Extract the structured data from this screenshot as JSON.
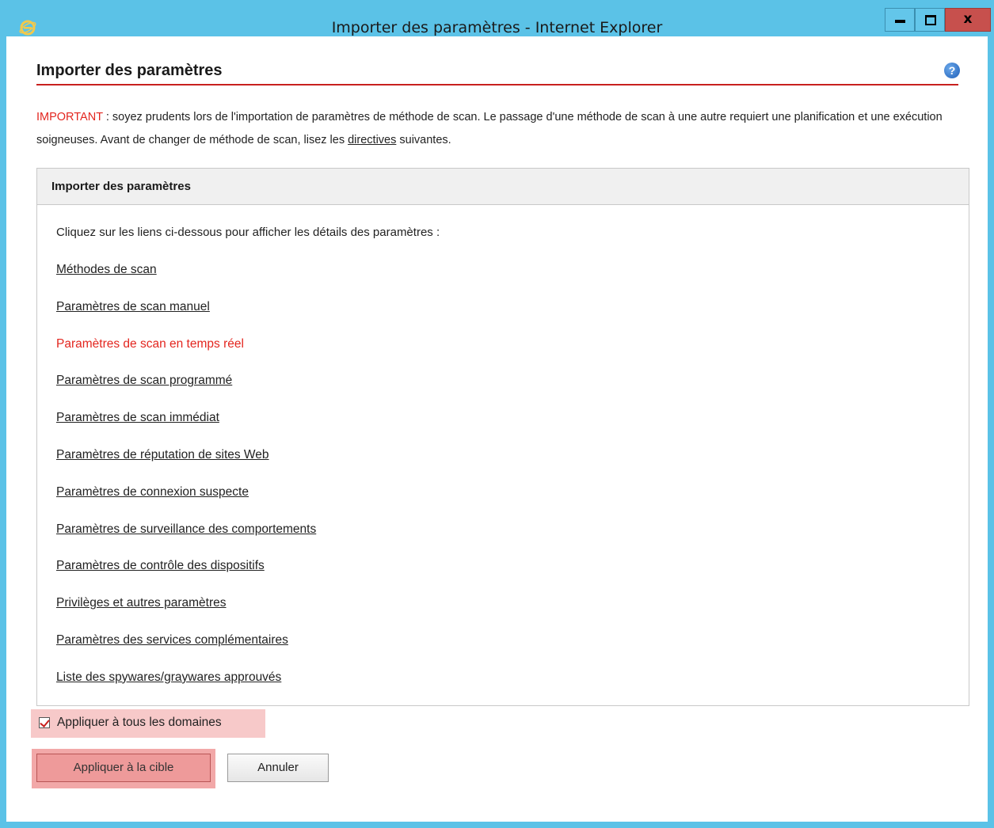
{
  "window": {
    "title": "Importer des paramètres - Internet Explorer",
    "minimize_label": "",
    "maximize_label": "",
    "close_label": "x",
    "titlebar_color": "#5bc2e7",
    "close_color": "#c7504d"
  },
  "page": {
    "title": "Importer des paramètres",
    "help_label": "?"
  },
  "notice": {
    "important_label": "IMPORTANT",
    "text_part1": " : soyez prudents lors de l'importation de paramètres de méthode de scan. Le passage d'une méthode de scan à une autre requiert une planification et une exécution soigneuses. Avant de changer de méthode de scan, lisez les ",
    "link_label": "directives",
    "text_part2": " suivantes."
  },
  "panel": {
    "header": "Importer des paramètres",
    "intro": "Cliquez sur les liens ci-dessous pour afficher les détails des paramètres :",
    "links": [
      {
        "label": "Méthodes de scan",
        "active": false
      },
      {
        "label": "Paramètres de scan manuel",
        "active": false
      },
      {
        "label": "Paramètres de scan en temps réel",
        "active": true
      },
      {
        "label": "Paramètres de scan programmé",
        "active": false
      },
      {
        "label": "Paramètres de scan immédiat",
        "active": false
      },
      {
        "label": "Paramètres de réputation de sites Web",
        "active": false
      },
      {
        "label": "Paramètres de connexion suspecte",
        "active": false
      },
      {
        "label": "Paramètres de surveillance des comportements",
        "active": false
      },
      {
        "label": "Paramètres de contrôle des dispositifs",
        "active": false
      },
      {
        "label": "Privilèges et autres paramètres",
        "active": false
      },
      {
        "label": "Paramètres des services complémentaires",
        "active": false
      },
      {
        "label": "Liste des spywares/graywares approuvés",
        "active": false
      }
    ]
  },
  "apply_all": {
    "label": "Appliquer à tous les domaines",
    "checked": true
  },
  "buttons": {
    "apply": "Appliquer à la cible",
    "cancel": "Annuler"
  },
  "colors": {
    "accent_red": "#c8201e",
    "important_red": "#e3261f",
    "highlight_pink": "#f7c9c9"
  }
}
